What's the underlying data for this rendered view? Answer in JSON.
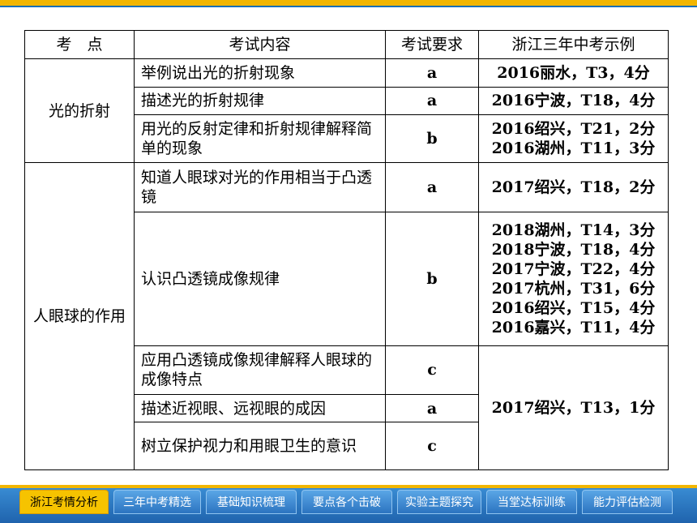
{
  "table": {
    "headers": [
      "考　点",
      "考试内容",
      "考试要求",
      "浙江三年中考示例"
    ],
    "groups": [
      {
        "point": "光的折射",
        "rows": [
          {
            "content": "举例说出光的折射现象",
            "req": "a",
            "examples": [
              "2016丽水，T3，4分"
            ]
          },
          {
            "content": "描述光的折射规律",
            "req": "a",
            "examples": [
              "2016宁波，T18，4分"
            ]
          },
          {
            "content": "用光的反射定律和折射规律解释简单的现象",
            "req": "b",
            "examples": [
              "2016绍兴，T21，2分",
              "2016湖州，T11，3分"
            ]
          }
        ]
      },
      {
        "point": "人眼球的作用",
        "rows": [
          {
            "content": "知道人眼球对光的作用相当于凸透镜",
            "req": "a",
            "examples": [
              "2017绍兴，T18，2分"
            ]
          },
          {
            "content": "认识凸透镜成像规律",
            "req": "b",
            "examples": [
              "2018湖州，T14，3分",
              "2018宁波，T18，4分",
              "2017宁波，T22，4分",
              "2017杭州，T31，6分",
              "2016绍兴，T15，4分",
              "2016嘉兴，T11，4分"
            ]
          },
          {
            "content": "应用凸透镜成像规律解释人眼球的成像特点",
            "req": "c"
          },
          {
            "content": "描述近视眼、远视眼的成因",
            "req": "a"
          },
          {
            "content": "树立保护视力和用眼卫生的意识",
            "req": "c"
          }
        ],
        "shared_example": "2017绍兴，T13，1分"
      }
    ]
  },
  "nav": {
    "tabs": [
      {
        "label": "浙江考情分析",
        "active": true
      },
      {
        "label": "三年中考精选",
        "active": false
      },
      {
        "label": "基础知识梳理",
        "active": false
      },
      {
        "label": "要点各个击破",
        "active": false
      },
      {
        "label": "实验主题探究",
        "active": false
      },
      {
        "label": "当堂达标训练",
        "active": false
      },
      {
        "label": "能力评估检测",
        "active": false
      }
    ]
  },
  "colors": {
    "accent_bar": "#f2b600",
    "nav_blue": "#1f63ad",
    "active_tab": "#f6c300"
  }
}
